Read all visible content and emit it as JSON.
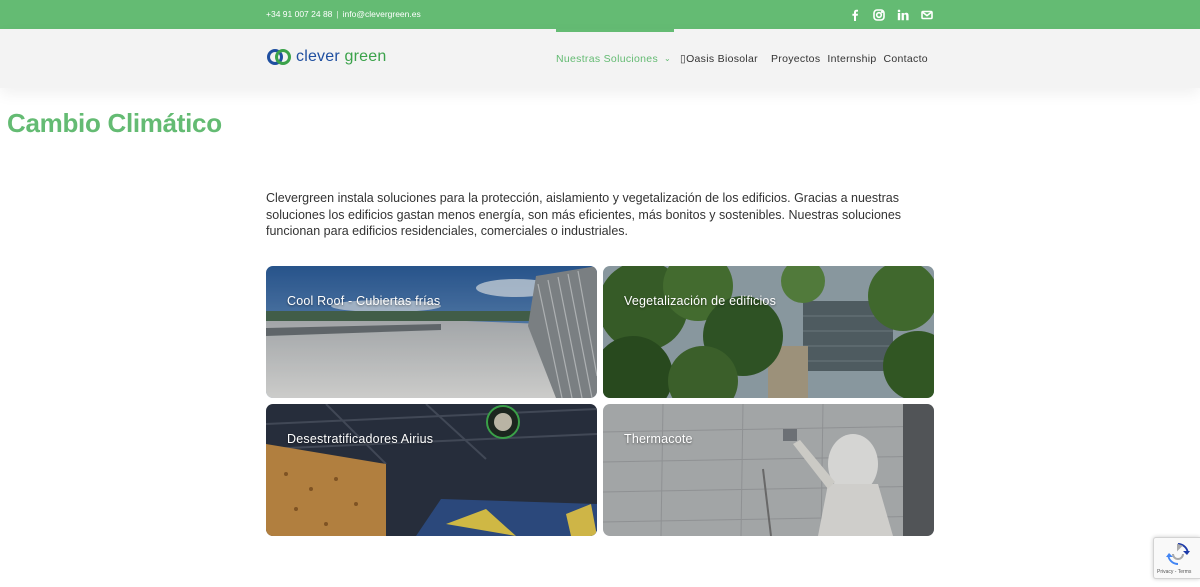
{
  "topbar": {
    "phone": "+34 91 007 24 88",
    "separator": "|",
    "email": "info@clevergreen.es",
    "socials": [
      "facebook-icon",
      "instagram-icon",
      "linkedin-icon",
      "mail-icon"
    ]
  },
  "logo": {
    "word1": "clever",
    "word2": "green"
  },
  "nav": {
    "items": [
      {
        "label": "Nuestras Soluciones",
        "active": true,
        "dropdown": true
      },
      {
        "label": "▯Oasis Biosolar"
      },
      {
        "label": "Proyectos"
      },
      {
        "label": "Internship"
      },
      {
        "label": "Contacto"
      }
    ]
  },
  "page": {
    "title": "Cambio Climático",
    "intro": "Clevergreen instala soluciones para la protección, aislamiento y vegetalización de los edificios. Gracias a nuestras soluciones los edificios gastan menos energía, son más eficientes, más bonitos y sostenibles. Nuestras soluciones funcionan para edificios residenciales, comerciales o industriales."
  },
  "cards": [
    {
      "label": "Cool Roof - Cubiertas frías"
    },
    {
      "label": "Vegetalización de edificios"
    },
    {
      "label": "Desestratificadores Airius"
    },
    {
      "label": "Thermacote"
    }
  ],
  "recaptcha": {
    "links": "Privacy - Terms"
  },
  "colors": {
    "brand_green": "#64bb73",
    "logo_blue": "#1f4fa0",
    "logo_green": "#3aa24a"
  }
}
